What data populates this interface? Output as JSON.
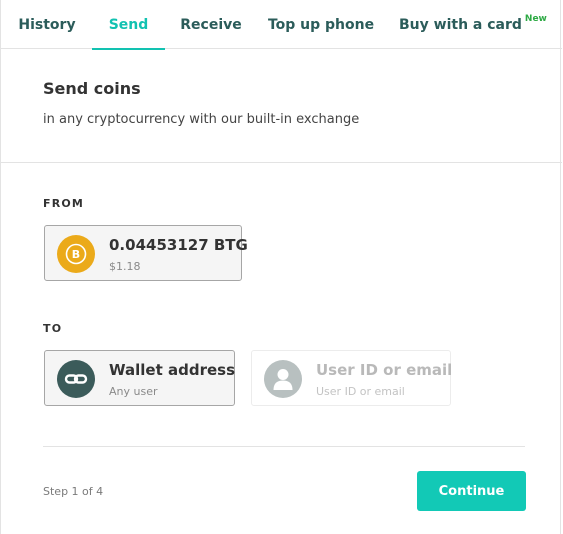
{
  "tabs": [
    {
      "label": "History",
      "active": false
    },
    {
      "label": "Send",
      "active": true
    },
    {
      "label": "Receive",
      "active": false
    },
    {
      "label": "Top up phone",
      "active": false
    },
    {
      "label": "Buy with a card",
      "active": false,
      "badge": "New"
    }
  ],
  "header": {
    "title": "Send coins",
    "subtitle": "in any cryptocurrency with our built-in exchange"
  },
  "from": {
    "label": "FROM",
    "amount": "0.04453127 BTG",
    "fiat": "$1.18",
    "icon": "bitcoin-gold-icon"
  },
  "to": {
    "label": "TO",
    "options": [
      {
        "title": "Wallet address",
        "subtitle": "Any user",
        "icon": "link-icon",
        "selected": true
      },
      {
        "title": "User ID or email",
        "subtitle": "User ID or email",
        "icon": "user-icon",
        "selected": false
      }
    ]
  },
  "footer": {
    "step": "Step 1 of 4",
    "continue_label": "Continue"
  },
  "colors": {
    "accent": "#12c9b6",
    "tab_text": "#2b5c5a",
    "new_badge": "#2eaa45",
    "btg_coin": "#ebaa1a",
    "wallet_icon_bg": "#3b5b5a"
  }
}
